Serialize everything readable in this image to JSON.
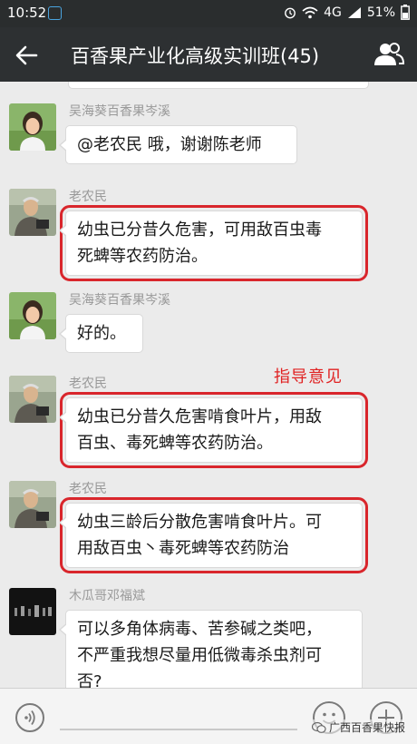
{
  "status_bar": {
    "time": "10:52",
    "network": "4G",
    "battery": "51%",
    "icons": [
      "alarm-icon",
      "wifi-icon",
      "signal-icon",
      "battery-icon"
    ]
  },
  "header": {
    "title": "百香果产业化高级实训班(45)",
    "back_icon": "back-arrow-icon",
    "members_icon": "group-members-icon"
  },
  "messages": [
    {
      "sender": "吴海葵百香果岑溪",
      "lines": [
        "@老农民 哦，谢谢陈老师"
      ],
      "marked": false
    },
    {
      "sender": "老农民",
      "lines": [
        "幼虫已分昔久危害，可用敌百虫毒",
        "死蜱等农药防治。"
      ],
      "marked": true
    },
    {
      "sender": "吴海葵百香果岑溪",
      "lines": [
        "好的。"
      ],
      "marked": false
    },
    {
      "sender": "老农民",
      "lines": [
        "幼虫已分昔久危害啃食叶片，用敌",
        "百虫、毒死蜱等农药防治。"
      ],
      "marked": true
    },
    {
      "sender": "老农民",
      "lines": [
        "幼虫三龄后分散危害啃食叶片。可",
        "用敌百虫丶毒死蜱等农药防治"
      ],
      "marked": true
    },
    {
      "sender": "木瓜哥邓福斌",
      "lines": [
        "可以多角体病毒、苦参碱之类吧，",
        "不严重我想尽量用低微毒杀虫剂可",
        "否?"
      ],
      "marked": false
    }
  ],
  "annotation": "指导意见",
  "input_bar": {
    "voice_icon": "voice-icon",
    "emoji_icon": "emoji-icon",
    "plus_icon": "plus-icon",
    "watermark": "广西百香果快报"
  },
  "colors": {
    "title_bar": "#2d3032",
    "status_bar": "#2a2d2e",
    "chat_background": "#ebebeb",
    "highlight_border": "#d9262c",
    "annotation_text": "#e02222"
  }
}
